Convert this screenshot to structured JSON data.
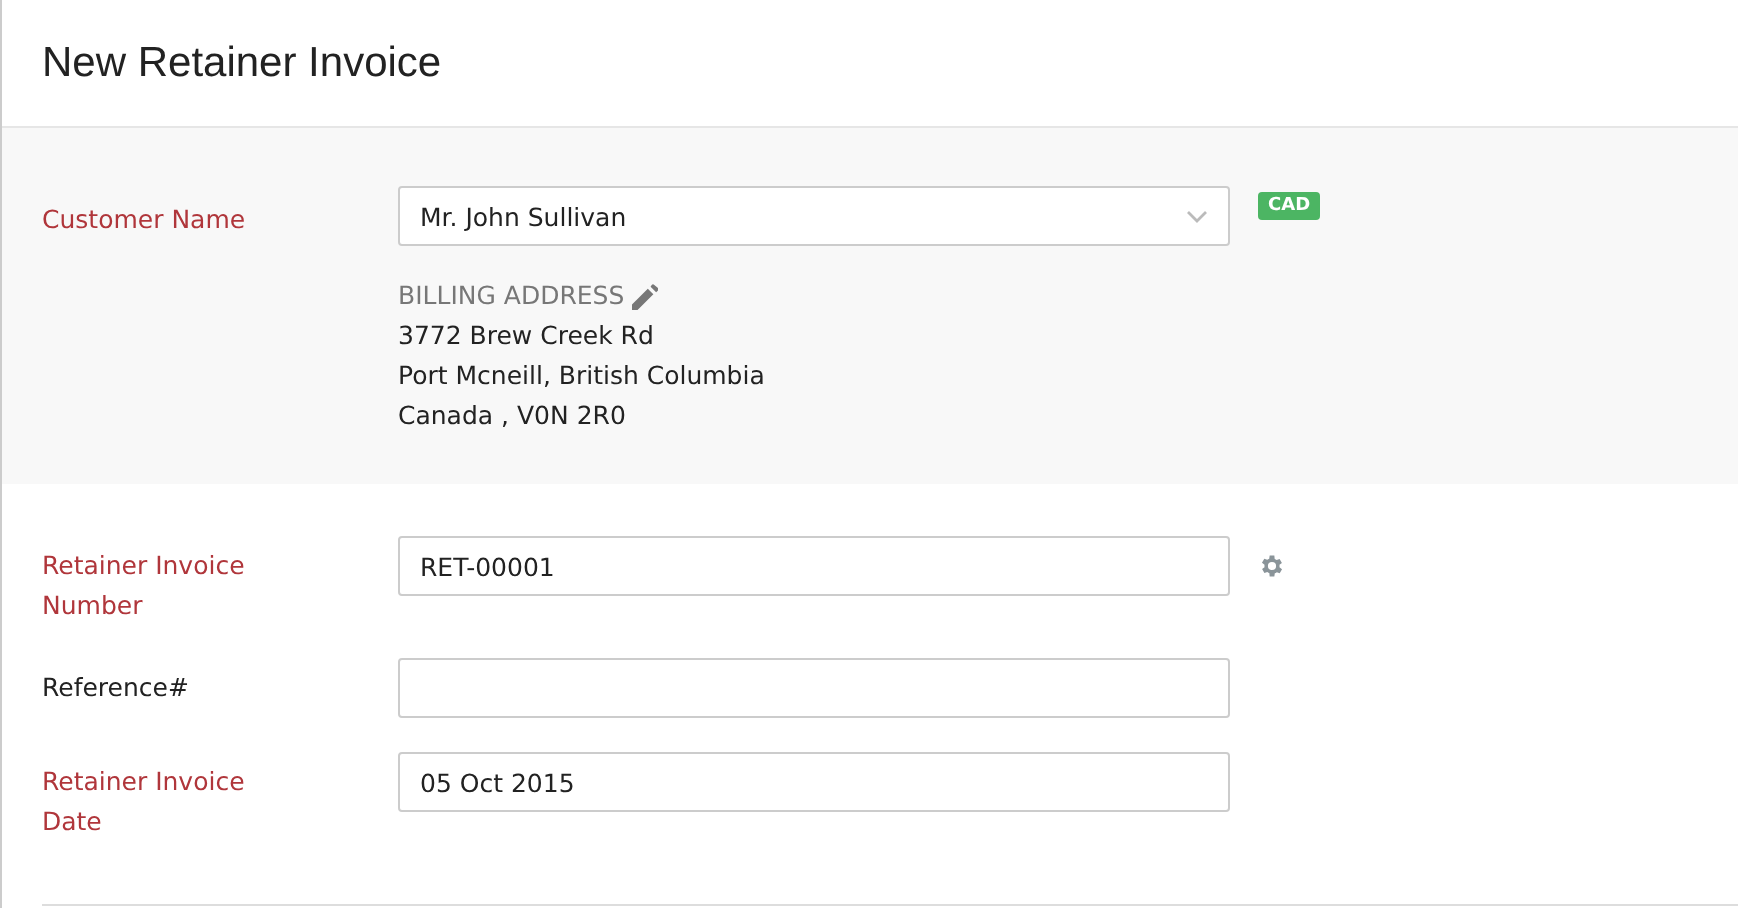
{
  "title": "New Retainer Invoice",
  "customer": {
    "label": "Customer Name",
    "required": true,
    "value": "Mr. John Sullivan",
    "currency": "CAD",
    "billing": {
      "heading": "BILLING ADDRESS",
      "lines": [
        "3772 Brew Creek Rd",
        "Port Mcneill, British Columbia",
        "Canada , V0N 2R0"
      ]
    }
  },
  "fields": [
    {
      "label": "Retainer Invoice Number",
      "required": true,
      "value": "RET-00001",
      "kind": "settings"
    },
    {
      "label": "Reference#",
      "required": false,
      "kind": "plain"
    },
    {
      "label": "Retainer Invoice Date",
      "required": true,
      "value": "05 Oct 2015",
      "kind": "plain"
    }
  ]
}
